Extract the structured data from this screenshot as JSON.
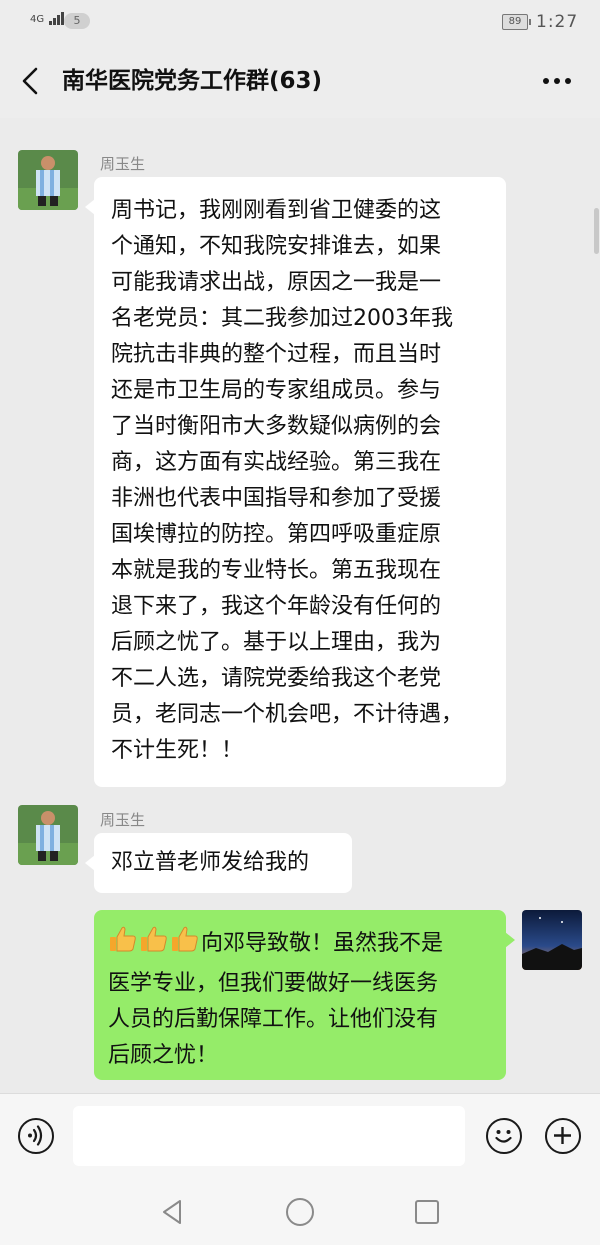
{
  "status_bar": {
    "network": "4G",
    "sim_badge": "5",
    "battery": "89",
    "time": "1:27"
  },
  "header": {
    "title": "南华医院党务工作群(63)",
    "back_icon": "chevron-left-icon",
    "more_icon": "ellipsis-icon"
  },
  "messages": [
    {
      "sender": "周玉生",
      "side": "left",
      "lines": [
        "周书记，我刚刚看到省卫健委的这",
        "个通知，不知我院安排谁去，如果",
        "可能我请求出战，原因之一我是一",
        "名老党员：其二我参加过2003年我",
        "院抗击非典的整个过程，而且当时",
        "还是市卫生局的专家组成员。参与",
        "了当时衡阳市大多数疑似病例的会",
        "商，这方面有实战经验。第三我在",
        "非洲也代表中国指导和参加了受援",
        "国埃博拉的防控。第四呼吸重症原",
        "本就是我的专业特长。第五我现在",
        "退下来了，我这个年龄没有任何的",
        "后顾之忧了。基于以上理由，我为",
        "不二人选，请院党委给我这个老党",
        "员，老同志一个机会吧，不计待遇，",
        "不计生死！！"
      ]
    },
    {
      "sender": "周玉生",
      "side": "left",
      "lines": [
        "邓立普老师发给我的"
      ]
    },
    {
      "sender": "",
      "side": "right",
      "emoji": "thumbs-up-icon",
      "emoji_count": 3,
      "lines": [
        "向邓导致敬！虽然我不是",
        "医学专业，但我们要做好一线医务",
        "人员的后勤保障工作。让他们没有",
        "后顾之忧！"
      ]
    }
  ],
  "input_bar": {
    "voice_icon": "voice-input-icon",
    "emoji_icon": "smiley-icon",
    "plus_icon": "plus-icon",
    "text_value": ""
  },
  "nav_bar": {
    "back_icon": "triangle-back-icon",
    "home_icon": "circle-home-icon",
    "recents_icon": "square-recents-icon"
  },
  "colors": {
    "chat_background": "#ebebeb",
    "sent_bubble": "#95ec69",
    "received_bubble": "#ffffff"
  }
}
